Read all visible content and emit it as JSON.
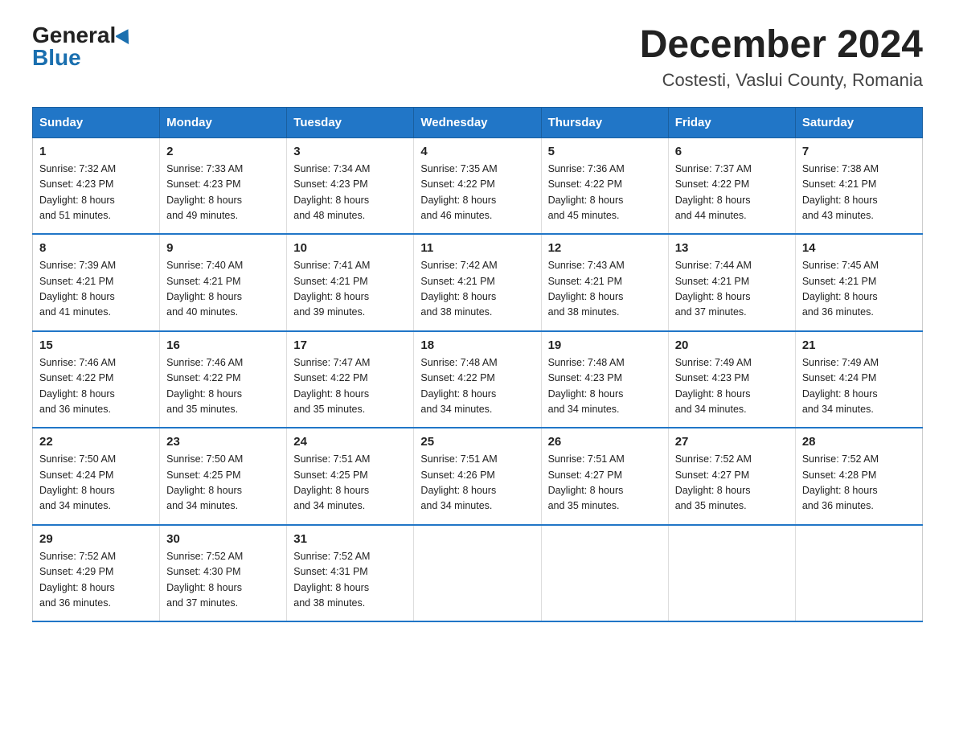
{
  "header": {
    "logo_general": "General",
    "logo_blue": "Blue",
    "month_year": "December 2024",
    "location": "Costesti, Vaslui County, Romania"
  },
  "weekdays": [
    "Sunday",
    "Monday",
    "Tuesday",
    "Wednesday",
    "Thursday",
    "Friday",
    "Saturday"
  ],
  "weeks": [
    [
      {
        "day": "1",
        "sunrise": "7:32 AM",
        "sunset": "4:23 PM",
        "daylight": "8 hours and 51 minutes."
      },
      {
        "day": "2",
        "sunrise": "7:33 AM",
        "sunset": "4:23 PM",
        "daylight": "8 hours and 49 minutes."
      },
      {
        "day": "3",
        "sunrise": "7:34 AM",
        "sunset": "4:23 PM",
        "daylight": "8 hours and 48 minutes."
      },
      {
        "day": "4",
        "sunrise": "7:35 AM",
        "sunset": "4:22 PM",
        "daylight": "8 hours and 46 minutes."
      },
      {
        "day": "5",
        "sunrise": "7:36 AM",
        "sunset": "4:22 PM",
        "daylight": "8 hours and 45 minutes."
      },
      {
        "day": "6",
        "sunrise": "7:37 AM",
        "sunset": "4:22 PM",
        "daylight": "8 hours and 44 minutes."
      },
      {
        "day": "7",
        "sunrise": "7:38 AM",
        "sunset": "4:21 PM",
        "daylight": "8 hours and 43 minutes."
      }
    ],
    [
      {
        "day": "8",
        "sunrise": "7:39 AM",
        "sunset": "4:21 PM",
        "daylight": "8 hours and 41 minutes."
      },
      {
        "day": "9",
        "sunrise": "7:40 AM",
        "sunset": "4:21 PM",
        "daylight": "8 hours and 40 minutes."
      },
      {
        "day": "10",
        "sunrise": "7:41 AM",
        "sunset": "4:21 PM",
        "daylight": "8 hours and 39 minutes."
      },
      {
        "day": "11",
        "sunrise": "7:42 AM",
        "sunset": "4:21 PM",
        "daylight": "8 hours and 38 minutes."
      },
      {
        "day": "12",
        "sunrise": "7:43 AM",
        "sunset": "4:21 PM",
        "daylight": "8 hours and 38 minutes."
      },
      {
        "day": "13",
        "sunrise": "7:44 AM",
        "sunset": "4:21 PM",
        "daylight": "8 hours and 37 minutes."
      },
      {
        "day": "14",
        "sunrise": "7:45 AM",
        "sunset": "4:21 PM",
        "daylight": "8 hours and 36 minutes."
      }
    ],
    [
      {
        "day": "15",
        "sunrise": "7:46 AM",
        "sunset": "4:22 PM",
        "daylight": "8 hours and 36 minutes."
      },
      {
        "day": "16",
        "sunrise": "7:46 AM",
        "sunset": "4:22 PM",
        "daylight": "8 hours and 35 minutes."
      },
      {
        "day": "17",
        "sunrise": "7:47 AM",
        "sunset": "4:22 PM",
        "daylight": "8 hours and 35 minutes."
      },
      {
        "day": "18",
        "sunrise": "7:48 AM",
        "sunset": "4:22 PM",
        "daylight": "8 hours and 34 minutes."
      },
      {
        "day": "19",
        "sunrise": "7:48 AM",
        "sunset": "4:23 PM",
        "daylight": "8 hours and 34 minutes."
      },
      {
        "day": "20",
        "sunrise": "7:49 AM",
        "sunset": "4:23 PM",
        "daylight": "8 hours and 34 minutes."
      },
      {
        "day": "21",
        "sunrise": "7:49 AM",
        "sunset": "4:24 PM",
        "daylight": "8 hours and 34 minutes."
      }
    ],
    [
      {
        "day": "22",
        "sunrise": "7:50 AM",
        "sunset": "4:24 PM",
        "daylight": "8 hours and 34 minutes."
      },
      {
        "day": "23",
        "sunrise": "7:50 AM",
        "sunset": "4:25 PM",
        "daylight": "8 hours and 34 minutes."
      },
      {
        "day": "24",
        "sunrise": "7:51 AM",
        "sunset": "4:25 PM",
        "daylight": "8 hours and 34 minutes."
      },
      {
        "day": "25",
        "sunrise": "7:51 AM",
        "sunset": "4:26 PM",
        "daylight": "8 hours and 34 minutes."
      },
      {
        "day": "26",
        "sunrise": "7:51 AM",
        "sunset": "4:27 PM",
        "daylight": "8 hours and 35 minutes."
      },
      {
        "day": "27",
        "sunrise": "7:52 AM",
        "sunset": "4:27 PM",
        "daylight": "8 hours and 35 minutes."
      },
      {
        "day": "28",
        "sunrise": "7:52 AM",
        "sunset": "4:28 PM",
        "daylight": "8 hours and 36 minutes."
      }
    ],
    [
      {
        "day": "29",
        "sunrise": "7:52 AM",
        "sunset": "4:29 PM",
        "daylight": "8 hours and 36 minutes."
      },
      {
        "day": "30",
        "sunrise": "7:52 AM",
        "sunset": "4:30 PM",
        "daylight": "8 hours and 37 minutes."
      },
      {
        "day": "31",
        "sunrise": "7:52 AM",
        "sunset": "4:31 PM",
        "daylight": "8 hours and 38 minutes."
      },
      null,
      null,
      null,
      null
    ]
  ]
}
